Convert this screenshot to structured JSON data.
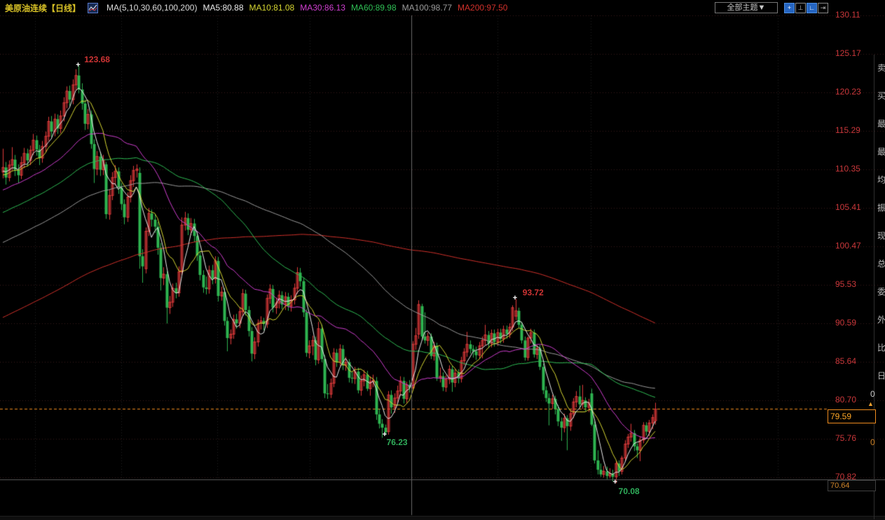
{
  "header": {
    "title": "美原油连续",
    "period": "【日线】",
    "ma_label": "MA(5,10,30,60,100,200)",
    "ma_items": [
      {
        "label": "MA5:80.88",
        "color": "#ececec"
      },
      {
        "label": "MA10:81.08",
        "color": "#d8d832"
      },
      {
        "label": "MA30:86.13",
        "color": "#d23fd2"
      },
      {
        "label": "MA60:89.98",
        "color": "#2fbf55"
      },
      {
        "label": "MA100:98.77",
        "color": "#9c9c9c"
      },
      {
        "label": "MA200:97.50",
        "color": "#d2312b"
      }
    ]
  },
  "controls": {
    "theme_dropdown_label": "全部主题▼",
    "buttons": [
      {
        "name": "pan-tool-button",
        "glyph": "+",
        "style": "blue"
      },
      {
        "name": "axis-scale-button",
        "glyph": "⊥",
        "style": "gray"
      },
      {
        "name": "axis-measure-button",
        "glyph": "∟",
        "style": "blue"
      },
      {
        "name": "collapse-panel-button",
        "glyph": "⇥",
        "style": "gray"
      }
    ]
  },
  "axis": {
    "tick_labels": [
      "130.11",
      "125.17",
      "120.23",
      "115.29",
      "110.35",
      "105.41",
      "100.47",
      "95.53",
      "90.59",
      "85.64",
      "80.70",
      "75.76",
      "70.82"
    ],
    "color": "#c9373a"
  },
  "price_tag": {
    "value": "79.59",
    "arrow": "▲"
  },
  "low_tag": {
    "value": "70.64"
  },
  "side_strip": {
    "chars": [
      "卖",
      "买",
      "最",
      "最",
      "均",
      "振",
      "现",
      "总",
      "委",
      "外",
      "比",
      "日"
    ],
    "zeros": [
      "0",
      "0"
    ]
  },
  "chart_data": {
    "type": "candlestick",
    "title": "美原油连续 日线",
    "instrument": "美原油连续",
    "period": "日线",
    "legend_ma_values": {
      "MA5": 80.88,
      "MA10": 81.08,
      "MA30": 86.13,
      "MA60": 89.98,
      "MA100": 98.77,
      "MA200": 97.5
    },
    "ma_periods": [
      5,
      10,
      30,
      60,
      100,
      200
    ],
    "y_ticks": [
      130.11,
      125.17,
      120.23,
      115.29,
      110.35,
      105.41,
      100.47,
      95.53,
      90.59,
      85.64,
      80.7,
      75.76,
      70.82
    ],
    "ylim": [
      68.0,
      131.5
    ],
    "last_price": 79.59,
    "grid": "dotted",
    "legend_position": "top",
    "annotations": [
      {
        "idx": 25,
        "field": "h",
        "text": "123.68",
        "color": "#cf3434",
        "dx": 8,
        "dy": -16
      },
      {
        "idx": 169,
        "field": "h",
        "text": "93.72",
        "color": "#cf3434",
        "dx": 10,
        "dy": -16
      },
      {
        "idx": 126,
        "field": "l",
        "text": "76.23",
        "color": "#2fae5a",
        "dx": 2,
        "dy": 3
      },
      {
        "idx": 202,
        "field": "l",
        "text": "70.08",
        "color": "#2fae5a",
        "dx": 4,
        "dy": 5
      }
    ],
    "ma_seed": {
      "from": 72.0,
      "to": 110.3,
      "count": 200
    },
    "colors": {
      "up": "#e23b3b",
      "down": "#2eb450",
      "ma5": "#ececec",
      "ma10": "#d8d832",
      "ma30": "#d23fd2",
      "ma60": "#2fbf55",
      "ma100": "#9c9c9c",
      "ma200": "#d2312b",
      "grid": "rgba(190,95,95,0.30)",
      "vgrid": "rgba(160,160,160,0.22)",
      "price_line": "#f08c1e",
      "crosshair": "#6a6a6a",
      "pane_border": "#5a5a5a"
    },
    "vertical_gridlines_x": [
      50,
      173,
      310,
      442,
      710,
      843,
      1110
    ],
    "crosshair_x": 587,
    "candles": [
      [
        110.0,
        113.0,
        109.2,
        110.6
      ],
      [
        110.6,
        111.3,
        108.4,
        109.3
      ],
      [
        109.3,
        111.5,
        108.8,
        110.9
      ],
      [
        110.9,
        113.2,
        110.2,
        111.6
      ],
      [
        111.6,
        112.2,
        109.5,
        110.3
      ],
      [
        110.3,
        111.0,
        108.6,
        109.6
      ],
      [
        109.6,
        112.0,
        109.1,
        111.2
      ],
      [
        111.2,
        113.1,
        110.5,
        112.4
      ],
      [
        112.4,
        113.0,
        110.7,
        111.5
      ],
      [
        111.5,
        113.4,
        110.9,
        112.8
      ],
      [
        112.8,
        114.9,
        112.2,
        114.1
      ],
      [
        114.1,
        114.7,
        112.1,
        112.9
      ],
      [
        112.9,
        113.5,
        110.9,
        111.8
      ],
      [
        111.8,
        114.0,
        111.2,
        113.3
      ],
      [
        113.3,
        115.2,
        112.6,
        114.6
      ],
      [
        114.6,
        117.1,
        114.0,
        116.5
      ],
      [
        116.5,
        117.2,
        114.5,
        115.2
      ],
      [
        115.2,
        117.5,
        114.6,
        116.8
      ],
      [
        116.8,
        117.4,
        114.9,
        115.6
      ],
      [
        115.6,
        117.9,
        115.0,
        117.2
      ],
      [
        117.2,
        119.6,
        116.5,
        118.9
      ],
      [
        118.9,
        121.0,
        118.2,
        120.4
      ],
      [
        120.4,
        121.1,
        118.5,
        119.3
      ],
      [
        119.3,
        121.9,
        118.7,
        121.2
      ],
      [
        121.2,
        123.2,
        120.5,
        122.4
      ],
      [
        122.4,
        123.68,
        120.1,
        120.6
      ],
      [
        120.6,
        121.4,
        118.0,
        118.8
      ],
      [
        118.8,
        119.3,
        115.4,
        116.2
      ],
      [
        116.2,
        118.1,
        115.5,
        117.4
      ],
      [
        117.4,
        117.9,
        113.0,
        113.6
      ],
      [
        113.6,
        114.2,
        108.6,
        110.4
      ],
      [
        110.4,
        112.7,
        109.6,
        112.0
      ],
      [
        112.0,
        112.6,
        109.5,
        110.3
      ],
      [
        110.3,
        112.2,
        109.6,
        111.5
      ],
      [
        111.0,
        111.3,
        104.0,
        104.6
      ],
      [
        104.6,
        107.8,
        103.9,
        107.0
      ],
      [
        107.0,
        110.0,
        106.4,
        109.3
      ],
      [
        109.3,
        110.9,
        108.3,
        110.1
      ],
      [
        110.1,
        110.6,
        107.2,
        108.0
      ],
      [
        108.0,
        108.6,
        105.1,
        105.9
      ],
      [
        105.9,
        106.5,
        103.3,
        104.2
      ],
      [
        104.2,
        107.4,
        103.6,
        106.8
      ],
      [
        106.8,
        109.6,
        106.1,
        108.9
      ],
      [
        108.9,
        110.8,
        108.1,
        110.2
      ],
      [
        110.2,
        111.0,
        109.3,
        110.4
      ],
      [
        109.9,
        110.6,
        97.6,
        99.2
      ],
      [
        99.2,
        100.1,
        95.8,
        97.9
      ],
      [
        97.6,
        102.9,
        97.0,
        102.4
      ],
      [
        102.4,
        105.4,
        101.8,
        104.7
      ],
      [
        104.7,
        105.2,
        103.0,
        103.9
      ],
      [
        103.9,
        104.6,
        102.2,
        103.0
      ],
      [
        103.0,
        103.6,
        99.4,
        100.3
      ],
      [
        100.3,
        100.9,
        94.8,
        96.4
      ],
      [
        96.4,
        97.8,
        95.5,
        96.9
      ],
      [
        96.9,
        97.3,
        90.56,
        92.6
      ],
      [
        92.6,
        94.1,
        91.8,
        93.3
      ],
      [
        93.3,
        95.7,
        92.7,
        95.1
      ],
      [
        95.1,
        95.8,
        93.8,
        94.5
      ],
      [
        94.5,
        97.9,
        94.0,
        97.2
      ],
      [
        97.2,
        104.2,
        96.8,
        103.2
      ],
      [
        103.2,
        104.9,
        102.5,
        104.1
      ],
      [
        104.1,
        104.7,
        101.9,
        102.6
      ],
      [
        102.6,
        104.1,
        101.9,
        103.4
      ],
      [
        103.4,
        104.0,
        101.0,
        101.8
      ],
      [
        101.8,
        102.4,
        98.6,
        99.3
      ],
      [
        99.3,
        99.9,
        96.1,
        96.8
      ],
      [
        96.8,
        97.4,
        94.5,
        95.2
      ],
      [
        95.2,
        96.6,
        94.3,
        95.0
      ],
      [
        95.0,
        98.0,
        94.4,
        97.4
      ],
      [
        97.4,
        98.1,
        95.6,
        96.3
      ],
      [
        96.3,
        99.2,
        95.7,
        98.6
      ],
      [
        98.6,
        99.1,
        93.4,
        94.1
      ],
      [
        94.1,
        95.3,
        93.5,
        94.6
      ],
      [
        94.6,
        95.1,
        90.3,
        90.9
      ],
      [
        90.9,
        91.4,
        87.0,
        88.7
      ],
      [
        88.7,
        89.8,
        87.9,
        89.2
      ],
      [
        89.2,
        91.7,
        88.6,
        91.1
      ],
      [
        91.1,
        91.8,
        89.9,
        90.6
      ],
      [
        90.6,
        92.7,
        90.0,
        92.1
      ],
      [
        92.1,
        95.0,
        91.5,
        94.4
      ],
      [
        94.4,
        94.9,
        91.6,
        92.3
      ],
      [
        92.3,
        92.8,
        88.9,
        89.6
      ],
      [
        89.6,
        90.1,
        85.7,
        86.7
      ],
      [
        86.7,
        88.8,
        86.0,
        88.2
      ],
      [
        88.2,
        91.1,
        87.6,
        90.6
      ],
      [
        90.6,
        91.5,
        89.8,
        90.9
      ],
      [
        90.9,
        91.3,
        89.7,
        90.5
      ],
      [
        90.5,
        94.3,
        90.0,
        93.8
      ],
      [
        93.8,
        95.6,
        93.1,
        95.0
      ],
      [
        95.0,
        95.5,
        92.0,
        92.6
      ],
      [
        92.6,
        93.9,
        91.8,
        93.2
      ],
      [
        93.2,
        94.8,
        92.5,
        94.2
      ],
      [
        94.2,
        94.7,
        92.4,
        93.0
      ],
      [
        93.0,
        94.6,
        92.3,
        94.0
      ],
      [
        94.0,
        94.5,
        92.2,
        92.8
      ],
      [
        92.8,
        94.2,
        92.1,
        93.6
      ],
      [
        93.6,
        95.7,
        93.0,
        95.1
      ],
      [
        95.1,
        97.8,
        94.4,
        97.1
      ],
      [
        97.1,
        97.7,
        95.3,
        96.0
      ],
      [
        96.0,
        96.5,
        91.4,
        92.0
      ],
      [
        92.0,
        92.4,
        86.3,
        86.8
      ],
      [
        86.8,
        88.4,
        86.1,
        87.7
      ],
      [
        87.7,
        89.0,
        86.5,
        88.4
      ],
      [
        88.4,
        88.9,
        85.2,
        85.9
      ],
      [
        85.9,
        90.8,
        85.4,
        89.9
      ],
      [
        89.9,
        90.4,
        85.6,
        86.0
      ],
      [
        86.0,
        86.5,
        81.0,
        81.6
      ],
      [
        81.6,
        82.8,
        80.9,
        81.5
      ],
      [
        81.5,
        83.5,
        81.0,
        82.9
      ],
      [
        82.9,
        87.4,
        82.4,
        86.8
      ],
      [
        86.8,
        87.3,
        85.0,
        85.6
      ],
      [
        85.6,
        87.9,
        85.1,
        87.3
      ],
      [
        87.3,
        87.8,
        84.6,
        85.2
      ],
      [
        85.2,
        86.3,
        84.5,
        85.6
      ],
      [
        85.6,
        86.0,
        83.0,
        83.6
      ],
      [
        83.6,
        84.4,
        82.9,
        83.5
      ],
      [
        83.5,
        85.0,
        82.8,
        84.4
      ],
      [
        84.4,
        84.9,
        81.6,
        82.0
      ],
      [
        82.0,
        83.9,
        81.3,
        83.2
      ],
      [
        83.2,
        84.6,
        82.5,
        84.0
      ],
      [
        84.0,
        84.5,
        81.9,
        82.2
      ],
      [
        82.2,
        83.8,
        81.3,
        83.1
      ],
      [
        83.1,
        84.0,
        82.4,
        83.3
      ],
      [
        83.2,
        83.7,
        78.2,
        78.9
      ],
      [
        78.9,
        79.6,
        77.1,
        77.7
      ],
      [
        77.7,
        78.3,
        75.9,
        77.2
      ],
      [
        77.2,
        77.6,
        76.23,
        76.6
      ],
      [
        76.7,
        81.9,
        76.3,
        81.4
      ],
      [
        81.4,
        82.0,
        79.0,
        79.8
      ],
      [
        79.8,
        81.6,
        79.1,
        81.0
      ],
      [
        81.0,
        82.6,
        80.4,
        81.9
      ],
      [
        81.9,
        83.8,
        81.3,
        83.2
      ],
      [
        83.2,
        83.7,
        80.3,
        80.9
      ],
      [
        80.9,
        83.1,
        80.4,
        82.7
      ],
      [
        82.7,
        83.3,
        81.7,
        82.3
      ],
      [
        82.3,
        88.3,
        82.0,
        87.9
      ],
      [
        87.9,
        90.0,
        87.2,
        89.0
      ],
      [
        89.2,
        93.55,
        88.6,
        93.0
      ],
      [
        92.8,
        93.1,
        88.5,
        88.9
      ],
      [
        88.9,
        92.0,
        88.0,
        88.4
      ],
      [
        88.4,
        89.4,
        87.7,
        88.9
      ],
      [
        88.9,
        89.3,
        86.0,
        86.4
      ],
      [
        86.4,
        88.2,
        85.8,
        87.7
      ],
      [
        87.7,
        88.1,
        83.2,
        83.6
      ],
      [
        83.6,
        84.9,
        83.0,
        83.8
      ],
      [
        83.8,
        84.3,
        81.9,
        82.4
      ],
      [
        82.4,
        83.9,
        81.8,
        83.4
      ],
      [
        83.4,
        85.2,
        82.8,
        84.7
      ],
      [
        84.7,
        85.1,
        81.8,
        83.0
      ],
      [
        83.0,
        84.7,
        82.4,
        84.2
      ],
      [
        84.2,
        84.7,
        82.9,
        83.5
      ],
      [
        83.5,
        86.3,
        83.0,
        85.8
      ],
      [
        85.8,
        87.4,
        85.2,
        86.9
      ],
      [
        86.9,
        89.5,
        86.3,
        87.9
      ],
      [
        87.9,
        88.4,
        86.7,
        87.3
      ],
      [
        87.3,
        87.8,
        86.2,
        87.0
      ],
      [
        87.0,
        87.6,
        85.9,
        86.5
      ],
      [
        86.5,
        88.2,
        86.0,
        87.7
      ],
      [
        87.7,
        88.9,
        86.1,
        88.4
      ],
      [
        88.4,
        90.4,
        87.8,
        89.1
      ],
      [
        89.1,
        89.6,
        87.4,
        88.0
      ],
      [
        88.0,
        89.8,
        87.5,
        89.3
      ],
      [
        89.3,
        89.8,
        87.6,
        88.2
      ],
      [
        88.2,
        89.9,
        87.7,
        89.4
      ],
      [
        89.4,
        89.9,
        88.0,
        88.6
      ],
      [
        88.6,
        90.3,
        88.1,
        89.8
      ],
      [
        89.8,
        90.3,
        88.6,
        89.2
      ],
      [
        89.2,
        90.6,
        88.7,
        90.1
      ],
      [
        90.1,
        92.9,
        89.6,
        92.6
      ],
      [
        91.5,
        93.72,
        91.0,
        92.2
      ],
      [
        92.2,
        92.6,
        90.0,
        90.4
      ],
      [
        90.4,
        90.8,
        88.0,
        88.4
      ],
      [
        88.4,
        88.9,
        85.8,
        86.2
      ],
      [
        86.2,
        88.9,
        85.8,
        88.7
      ],
      [
        88.7,
        89.9,
        88.0,
        89.4
      ],
      [
        89.4,
        89.8,
        86.2,
        86.6
      ],
      [
        86.6,
        87.8,
        86.0,
        87.4
      ],
      [
        87.4,
        87.8,
        84.6,
        85.0
      ],
      [
        85.0,
        85.4,
        81.5,
        82.0
      ],
      [
        82.0,
        82.5,
        80.5,
        81.0
      ],
      [
        81.0,
        81.6,
        77.5,
        80.3
      ],
      [
        80.3,
        81.4,
        79.6,
        80.9
      ],
      [
        80.9,
        81.3,
        78.9,
        79.6
      ],
      [
        79.6,
        80.1,
        77.4,
        78.0
      ],
      [
        78.0,
        78.5,
        75.5,
        77.2
      ],
      [
        77.2,
        79.0,
        76.6,
        78.4
      ],
      [
        78.4,
        78.8,
        74.3,
        77.4
      ],
      [
        77.4,
        79.5,
        76.8,
        79.0
      ],
      [
        79.0,
        81.0,
        78.4,
        80.5
      ],
      [
        80.5,
        81.9,
        79.8,
        81.2
      ],
      [
        81.2,
        82.6,
        79.7,
        80.2
      ],
      [
        80.2,
        82.7,
        79.6,
        80.7
      ],
      [
        80.7,
        81.1,
        79.3,
        79.8
      ],
      [
        79.8,
        80.9,
        79.2,
        80.4
      ],
      [
        81.6,
        82.2,
        77.4,
        77.6
      ],
      [
        77.6,
        78.0,
        72.6,
        73.0
      ],
      [
        73.0,
        74.3,
        71.2,
        71.8
      ],
      [
        71.8,
        72.6,
        70.9,
        71.2
      ],
      [
        71.2,
        72.3,
        70.8,
        71.6
      ],
      [
        71.6,
        72.2,
        70.6,
        71.0
      ],
      [
        71.0,
        72.0,
        70.7,
        71.3
      ],
      [
        71.3,
        71.8,
        70.3,
        70.9
      ],
      [
        70.9,
        72.9,
        70.08,
        72.6
      ],
      [
        72.6,
        73.0,
        71.0,
        71.6
      ],
      [
        71.6,
        73.6,
        71.2,
        73.3
      ],
      [
        73.3,
        75.6,
        72.9,
        75.1
      ],
      [
        75.1,
        76.4,
        74.6,
        76.0
      ],
      [
        76.0,
        77.7,
        75.4,
        76.5
      ],
      [
        76.5,
        76.9,
        74.2,
        74.8
      ],
      [
        74.8,
        75.2,
        73.3,
        74.3
      ],
      [
        74.3,
        76.1,
        72.9,
        75.6
      ],
      [
        75.6,
        77.9,
        75.2,
        77.5
      ],
      [
        77.5,
        77.9,
        76.2,
        76.7
      ],
      [
        76.7,
        78.2,
        76.1,
        77.8
      ],
      [
        77.8,
        78.9,
        77.0,
        78.5
      ],
      [
        78.1,
        80.4,
        77.6,
        79.59
      ]
    ]
  }
}
